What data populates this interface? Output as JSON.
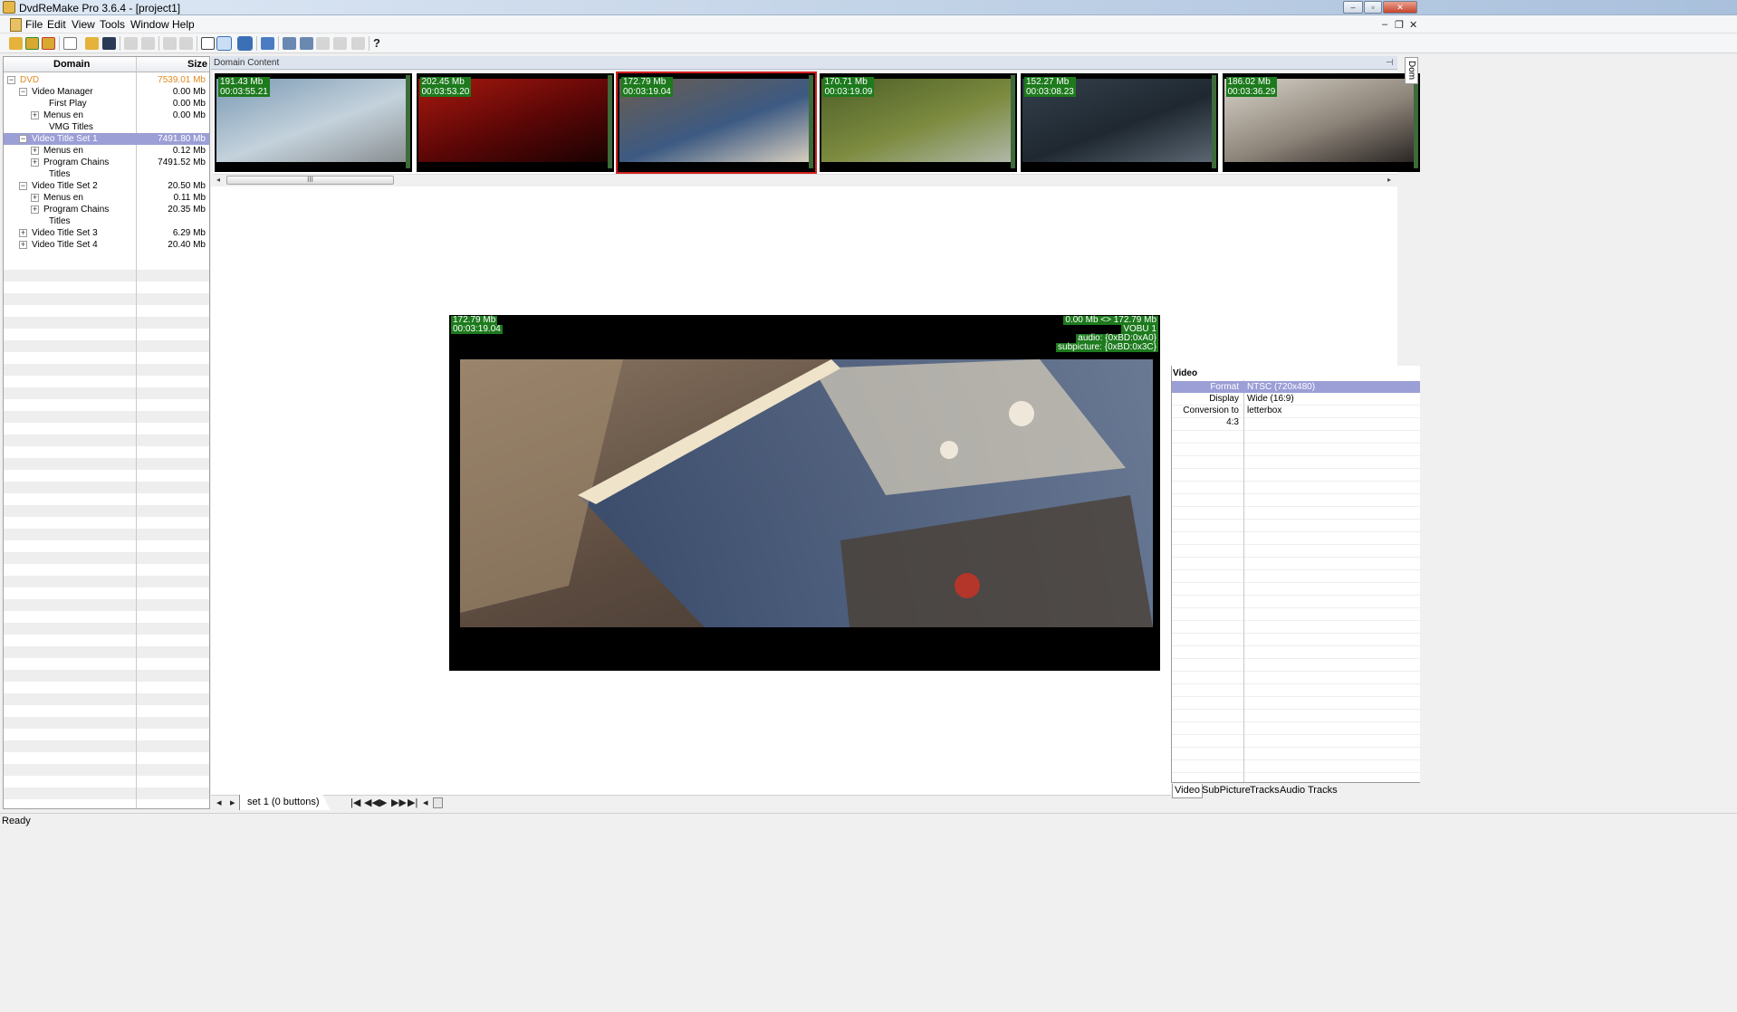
{
  "window": {
    "title": "DvdReMake Pro 3.6.4 - [project1]",
    "minimize": "–",
    "maximize": "▫",
    "close": "✕"
  },
  "menu": {
    "items": [
      "File",
      "Edit",
      "View",
      "Tools",
      "Window",
      "Help"
    ],
    "mdi_minimize": "–",
    "mdi_restore": "❐",
    "mdi_close": "✕"
  },
  "toolbar": {
    "icons": [
      "open-folder-icon",
      "open-project-icon",
      "export-icon",
      "new-document-icon",
      "open-file-icon",
      "save-icon",
      "undo-icon",
      "redo-icon",
      "back-icon",
      "forward-icon",
      "view-table-icon",
      "view-thumbs-icon",
      "view-preview-icon",
      "navigate-icon",
      "sort-icon",
      "merge-icon",
      "split-icon",
      "delete-icon",
      "blank-icon",
      "help-icon"
    ]
  },
  "tree": {
    "columns": {
      "domain": "Domain",
      "size": "Size"
    },
    "rows": [
      {
        "name": "DVD",
        "size": "7539.01 Mb",
        "level": 0,
        "toggle": "−",
        "highlight": "orange"
      },
      {
        "name": "Video Manager",
        "size": "0.00 Mb",
        "level": 1,
        "toggle": "−"
      },
      {
        "name": "First Play",
        "size": "0.00 Mb",
        "level": 2,
        "toggle": ""
      },
      {
        "name": "Menus en",
        "size": "0.00 Mb",
        "level": 2,
        "toggle": "+"
      },
      {
        "name": "VMG Titles",
        "size": "",
        "level": 2,
        "toggle": ""
      },
      {
        "name": "Video Title Set 1",
        "size": "7491.80 Mb",
        "level": 1,
        "toggle": "−",
        "selected": true
      },
      {
        "name": "Menus en",
        "size": "0.12 Mb",
        "level": 2,
        "toggle": "+"
      },
      {
        "name": "Program Chains",
        "size": "7491.52 Mb",
        "level": 2,
        "toggle": "+"
      },
      {
        "name": "Titles",
        "size": "",
        "level": 2,
        "toggle": ""
      },
      {
        "name": "Video Title Set 2",
        "size": "20.50 Mb",
        "level": 1,
        "toggle": "−"
      },
      {
        "name": "Menus en",
        "size": "0.11 Mb",
        "level": 2,
        "toggle": "+"
      },
      {
        "name": "Program Chains",
        "size": "20.35 Mb",
        "level": 2,
        "toggle": "+"
      },
      {
        "name": "Titles",
        "size": "",
        "level": 2,
        "toggle": ""
      },
      {
        "name": "Video Title Set 3",
        "size": "6.29 Mb",
        "level": 1,
        "toggle": "+"
      },
      {
        "name": "Video Title Set 4",
        "size": "20.40 Mb",
        "level": 1,
        "toggle": "+"
      }
    ]
  },
  "domain_content": {
    "title": "Domain Content",
    "pin": "⊣",
    "thumbnails": [
      {
        "size": "191.43 Mb",
        "time": "00:03:55.21",
        "colors": [
          "#7b9ab4",
          "#c4d2dc",
          "#8a8f92"
        ]
      },
      {
        "size": "202.45 Mb",
        "time": "00:03:53.20",
        "colors": [
          "#a8190f",
          "#5a0606",
          "#1a0202"
        ]
      },
      {
        "size": "172.79 Mb",
        "time": "00:03:19.04",
        "colors": [
          "#6a5d50",
          "#3d5a82",
          "#d8cfbf"
        ],
        "selected": true
      },
      {
        "size": "170.71 Mb",
        "time": "00:03:19.09",
        "colors": [
          "#4d5f28",
          "#7c8b3f",
          "#b0b7a8"
        ]
      },
      {
        "size": "152.27 Mb",
        "time": "00:03:08.23",
        "colors": [
          "#34404d",
          "#1f2830",
          "#5a6672"
        ]
      },
      {
        "size": "186.02 Mb",
        "time": "00:03:36.29",
        "colors": [
          "#d7d2c8",
          "#8e857a",
          "#2b2624"
        ]
      }
    ],
    "scroll_grip": "III",
    "scroll_left": "◂",
    "scroll_right": "▸"
  },
  "preview": {
    "size": "172.79 Mb",
    "time": "00:03:19.04",
    "range": "0.00 Mb <> 172.79 Mb",
    "vobu": "VOBU 1",
    "audio": "audio: {0xBD:0xA0}",
    "subpicture": "subpicture: {0xBD:0x3C}"
  },
  "navbar": {
    "prev": "◂",
    "next": "▸",
    "tab": "set 1 (0 buttons)",
    "first": "|◀",
    "rewind": "◀◀",
    "play": "▶",
    "ffwd": "▶▶",
    "last": "▶|",
    "extra": "◂"
  },
  "properties": {
    "side_tab": "Dom",
    "title": "Video",
    "rows": [
      {
        "key": "Format",
        "value": "NTSC (720x480)",
        "selected": true
      },
      {
        "key": "Display",
        "value": "Wide (16:9)"
      },
      {
        "key": "Conversion to 4:3",
        "value": "letterbox"
      }
    ],
    "tabs": [
      "Video",
      "SubPicture",
      "Tracks",
      "Audio Tracks"
    ]
  },
  "status": {
    "text": "Ready"
  }
}
